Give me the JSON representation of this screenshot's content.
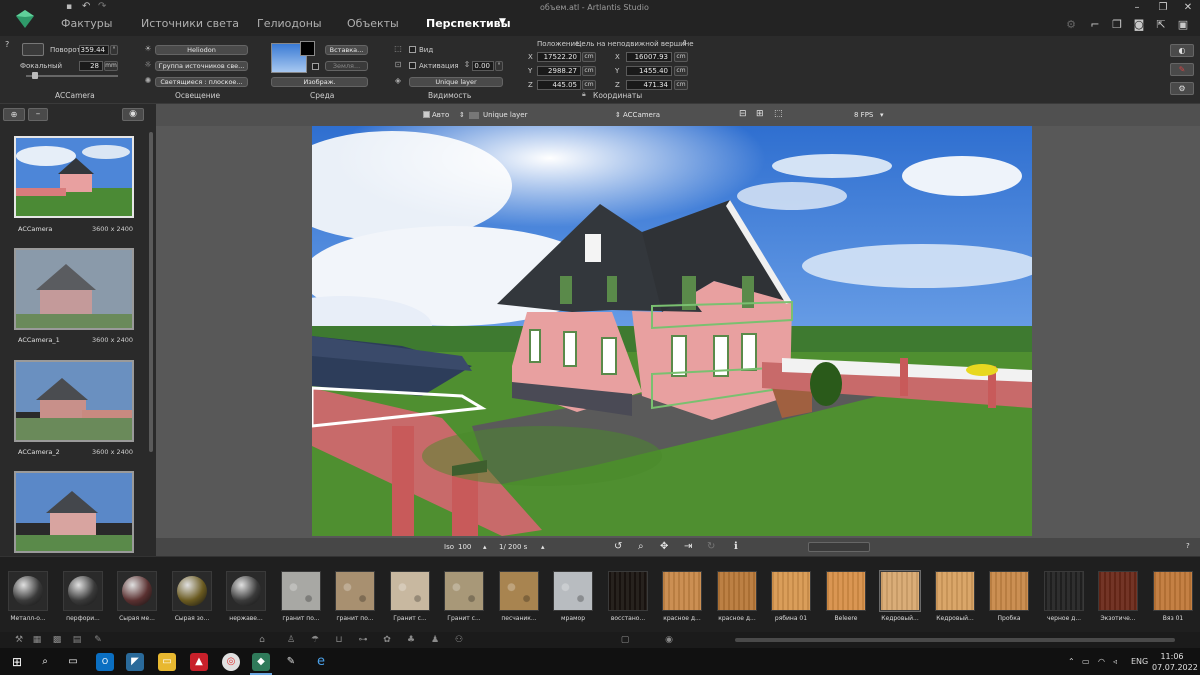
{
  "window": {
    "title": "объем.atl - Artlantis Studio"
  },
  "menu": {
    "tabs": [
      {
        "label": "Фактуры"
      },
      {
        "label": "Источники света"
      },
      {
        "label": "Гелиодоны"
      },
      {
        "label": "Объекты"
      },
      {
        "label": "Перспективы"
      }
    ],
    "active_tab": "Перспективы"
  },
  "toolbar": {
    "camera": {
      "rotation_label": "Поворот",
      "rotation_value": "359.44",
      "rotation_unit": "°",
      "focal_label": "Фокальный",
      "focal_value": "28",
      "focal_unit": "mm",
      "section_label": "ACCamera"
    },
    "lighting": {
      "heliodon": "Heliodon",
      "light_group": "Группа источников све...",
      "glowing": "Светящиеся : плоское...",
      "section_label": "Освещение"
    },
    "environment": {
      "insert_button": "Вставка...",
      "ground_label": "Земля...",
      "image_dropdown": "Изображ.",
      "section_label": "Среда"
    },
    "visibility": {
      "view_label": "Вид",
      "activation_label": "Активация",
      "activation_value": "0.00",
      "activation_unit": "°",
      "layer": "Unique layer",
      "section_label": "Видимость"
    },
    "coordinates": {
      "position_label": "Положение",
      "target_label": "Цель на неподвижной вершине",
      "position": {
        "x": "17522.20",
        "y": "2988.27",
        "z": "445.05"
      },
      "target": {
        "x": "16007.93",
        "y": "1455.40",
        "z": "471.34"
      },
      "unit": "cm",
      "axis_labels": [
        "X",
        "Y",
        "Z"
      ],
      "section_label": "Координаты"
    }
  },
  "left_panel": {
    "help": "?",
    "thumbnails": [
      {
        "name": "ACCamera",
        "size": "3600 x 2400",
        "selected": true
      },
      {
        "name": "ACCamera_1",
        "size": "3600 x 2400",
        "selected": false
      },
      {
        "name": "ACCamera_2",
        "size": "3600 x 2400",
        "selected": false
      },
      {
        "name": "",
        "size": "",
        "selected": false
      }
    ]
  },
  "viewport": {
    "auto_label": "Авто",
    "layer_label": "Unique layer",
    "camera_label": "ACCamera",
    "fps_label": "8 FPS",
    "iso_label": "Iso",
    "iso_value": "100",
    "shutter_value": "1/ 200 s",
    "help": "?"
  },
  "materials": [
    {
      "name": "Металл-о...",
      "color": "#3a3a3a",
      "kind": "sphere"
    },
    {
      "name": "перфори...",
      "color": "#3a3a3a",
      "kind": "sphere"
    },
    {
      "name": "Сырая ме...",
      "color": "#5a3030",
      "kind": "sphere"
    },
    {
      "name": "Сырая зо...",
      "color": "#6a5a20",
      "kind": "sphere"
    },
    {
      "name": "нержаве...",
      "color": "#3a3a3a",
      "kind": "sphere"
    },
    {
      "name": "гранит по...",
      "color": "#a8a8a4",
      "kind": "stone"
    },
    {
      "name": "гранит по...",
      "color": "#a89070",
      "kind": "stone"
    },
    {
      "name": "Гранит с...",
      "color": "#c8b8a0",
      "kind": "stone"
    },
    {
      "name": "Гранит с...",
      "color": "#a89878",
      "kind": "stone"
    },
    {
      "name": "песчаник...",
      "color": "#a88450",
      "kind": "stone"
    },
    {
      "name": "мрамор",
      "color": "#b8bcc0",
      "kind": "stone"
    },
    {
      "name": "восстано...",
      "color": "#1a1410",
      "kind": "wood"
    },
    {
      "name": "красное д...",
      "color": "#c88848",
      "kind": "wood"
    },
    {
      "name": "красное д...",
      "color": "#b87838",
      "kind": "wood"
    },
    {
      "name": "рябина 01",
      "color": "#d89850",
      "kind": "wood"
    },
    {
      "name": "Beleere",
      "color": "#d89048",
      "kind": "wood"
    },
    {
      "name": "Кедровый...",
      "color": "#d8a870",
      "kind": "wood"
    },
    {
      "name": "Кедровый...",
      "color": "#d8a060",
      "kind": "wood"
    },
    {
      "name": "Пробка",
      "color": "#c88848",
      "kind": "wood"
    },
    {
      "name": "черное д...",
      "color": "#222222",
      "kind": "wood"
    },
    {
      "name": "Экзотиче...",
      "color": "#6a2818",
      "kind": "wood"
    },
    {
      "name": "Вяз 01",
      "color": "#c07838",
      "kind": "wood"
    }
  ],
  "taskbar": {
    "language": "ENG",
    "time": "11:06",
    "date": "07.07.2022"
  }
}
